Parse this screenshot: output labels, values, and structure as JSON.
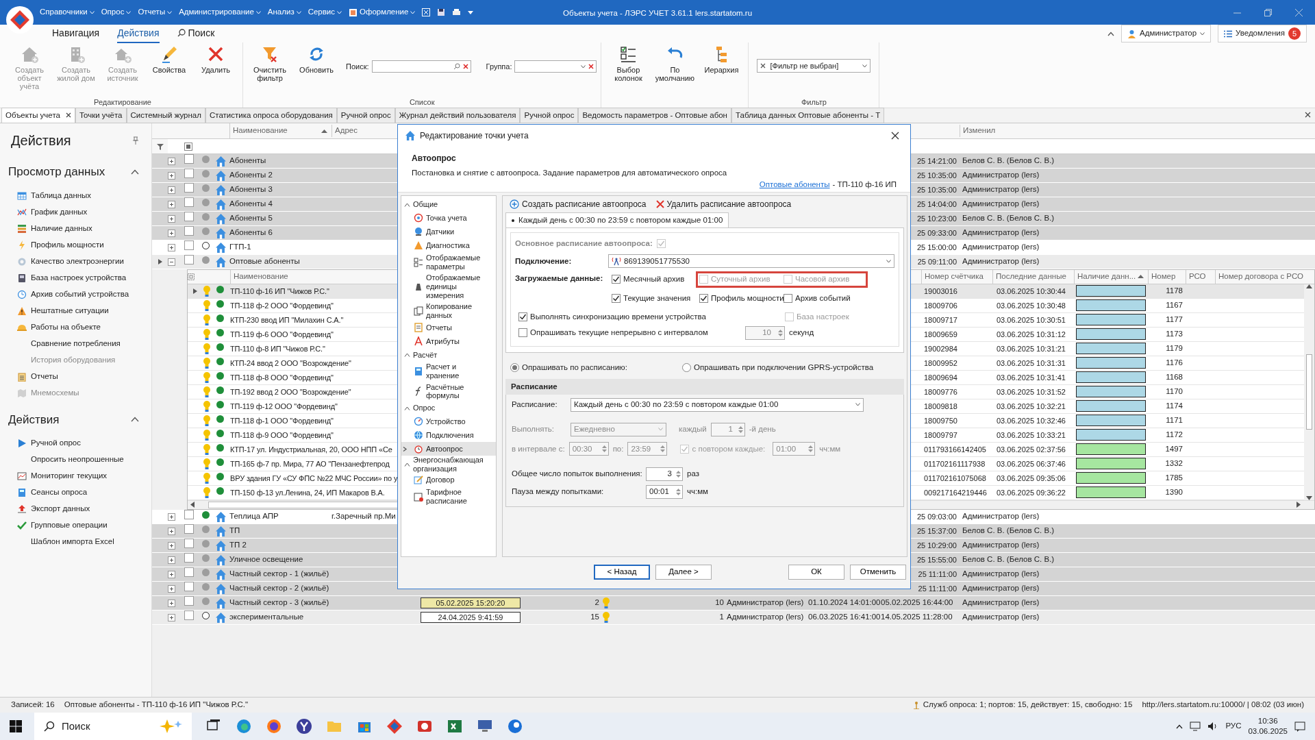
{
  "app": {
    "title": "Объекты учета - ЛЭРС УЧЕТ 3.61.1 lers.startatom.ru",
    "menu": [
      "Справочники",
      "Опрос",
      "Отчеты",
      "Администрирование",
      "Анализ",
      "Сервис",
      "Оформление"
    ]
  },
  "ribbon": {
    "tabs": [
      {
        "label": "Навигация",
        "selected": false
      },
      {
        "label": "Действия",
        "selected": true
      },
      {
        "label": "Поиск",
        "selected": false
      }
    ],
    "user": "Администратор",
    "notifications": {
      "label": "Уведомления",
      "count": "5"
    },
    "groups": [
      {
        "title": "Редактирование",
        "buttons": [
          {
            "label": "Создать объект учёта",
            "disabled": true
          },
          {
            "label": "Создать жилой дом",
            "disabled": true
          },
          {
            "label": "Создать источник",
            "disabled": true
          },
          {
            "label": "Свойства",
            "disabled": false
          },
          {
            "label": "Удалить",
            "disabled": false
          }
        ]
      },
      {
        "title": "Список",
        "buttons": [
          {
            "label": "Очистить фильтр",
            "disabled": false
          },
          {
            "label": "Обновить",
            "disabled": false
          }
        ],
        "search_label": "Поиск:",
        "group_label": "Группа:"
      },
      {
        "buttons": [
          {
            "label": "Выбор колонок",
            "disabled": false
          },
          {
            "label": "По умолчанию",
            "disabled": false
          },
          {
            "label": "Иерархия",
            "disabled": false
          }
        ]
      },
      {
        "title": "Фильтр",
        "filter": "[Фильтр не выбран]"
      }
    ]
  },
  "doc_tabs": [
    {
      "label": "Объекты учета",
      "selected": true
    },
    {
      "label": "Точки учёта",
      "selected": false
    },
    {
      "label": "Системный журнал",
      "selected": false
    },
    {
      "label": "Статистика опроса оборудования",
      "selected": false
    },
    {
      "label": "Ручной опрос",
      "selected": false
    },
    {
      "label": "Журнал действий пользователя",
      "selected": false
    },
    {
      "label": "Ручной опрос",
      "selected": false
    },
    {
      "label": "Ведомость параметров - Оптовые абон",
      "selected": false
    },
    {
      "label": "Таблица данных Оптовые абоненты - Т",
      "selected": false
    }
  ],
  "sidebar": {
    "title": "Действия",
    "sections": [
      {
        "title": "Просмотр данных",
        "expanded": true,
        "items": [
          {
            "label": "Таблица данных",
            "disabled": false
          },
          {
            "label": "График данных",
            "disabled": false
          },
          {
            "label": "Наличие данных",
            "disabled": false
          },
          {
            "label": "Профиль мощности",
            "disabled": false
          },
          {
            "label": "Качество электроэнергии",
            "disabled": false
          },
          {
            "label": "База настроек устройства",
            "disabled": false
          },
          {
            "label": "Архив событий устройства",
            "disabled": false
          },
          {
            "label": "Нештатные ситуации",
            "disabled": false
          },
          {
            "label": "Работы на объекте",
            "disabled": false
          },
          {
            "label": "Сравнение потребления",
            "disabled": false
          },
          {
            "label": "История оборудования",
            "disabled": true
          },
          {
            "label": "Отчеты",
            "disabled": false
          },
          {
            "label": "Мнемосхемы",
            "disabled": true
          }
        ]
      },
      {
        "title": "Действия",
        "expanded": true,
        "items": [
          {
            "label": "Ручной опрос",
            "disabled": false
          },
          {
            "label": "Опросить неопрошенные",
            "disabled": false
          },
          {
            "label": "Мониторинг текущих",
            "disabled": false
          },
          {
            "label": "Сеансы опроса",
            "disabled": false
          },
          {
            "label": "Экспорт данных",
            "disabled": false
          },
          {
            "label": "Групповые операции",
            "disabled": false
          },
          {
            "label": "Шаблон импорта Excel",
            "disabled": false
          }
        ]
      }
    ]
  },
  "grid": {
    "columns": [
      "Наименование",
      "Адрес",
      "Изменил"
    ],
    "rows": [
      {
        "name": "Абоненты",
        "color": "#d4d4d4",
        "dot": {
          "color": "#9d9d9d",
          "hollow": false
        },
        "checked": false,
        "expanded": false,
        "modified": "25 14:21:00",
        "modified_by": "Белов С. В. (Белов С. В.)"
      },
      {
        "name": "Абоненты 2",
        "color": "#d4d4d4",
        "dot": {
          "color": "#9d9d9d",
          "hollow": false
        },
        "checked": false,
        "expanded": false,
        "modified": "25 10:35:00",
        "modified_by": "Администратор (lers)"
      },
      {
        "name": "Абоненты 3",
        "color": "#d4d4d4",
        "dot": {
          "color": "#9d9d9d",
          "hollow": false
        },
        "checked": false,
        "expanded": false,
        "modified": "25 10:35:00",
        "modified_by": "Администратор (lers)"
      },
      {
        "name": "Абоненты 4",
        "color": "#d4d4d4",
        "dot": {
          "color": "#9d9d9d",
          "hollow": false
        },
        "checked": false,
        "expanded": false,
        "modified": "25 14:04:00",
        "modified_by": "Администратор (lers)"
      },
      {
        "name": "Абоненты 5",
        "color": "#d4d4d4",
        "dot": {
          "color": "#9d9d9d",
          "hollow": false
        },
        "checked": false,
        "expanded": false,
        "modified": "25 10:23:00",
        "modified_by": "Белов С. В. (Белов С. В.)"
      },
      {
        "name": "Абоненты 6",
        "color": "#d4d4d4",
        "dot": {
          "color": "#9d9d9d",
          "hollow": false
        },
        "checked": false,
        "expanded": false,
        "modified": "25 09:33:00",
        "modified_by": "Администратор (lers)"
      },
      {
        "name": "ГТП-1",
        "color": "#ffffff",
        "dot": {
          "color": "#ffffff",
          "hollow": true
        },
        "checked": false,
        "expanded": false,
        "modified": "25 15:00:00",
        "modified_by": "Администратор (lers)"
      },
      {
        "name": "Оптовые абоненты",
        "color": "#ebebeb",
        "dot": {
          "color": "#9d9d9d",
          "hollow": false
        },
        "checked": false,
        "expanded": true,
        "current": true,
        "modified": "25 09:11:00",
        "modified_by": "Администратор (lers)"
      }
    ],
    "detail": {
      "columns": [
        "Наименование",
        "Номер счётчика",
        "Последние данные",
        "Наличие данн...",
        "Номер",
        "РСО",
        "Номер договора с РСО"
      ],
      "rows": [
        {
          "name": "ТП-110 ф-16  ИП \"Чижов Р.С.\"",
          "meter": "19003016",
          "last": "03.06.2025 10:30:44",
          "color": "#add8e6",
          "number": "1178",
          "selected": true
        },
        {
          "name": "ТП-118 ф-2  ООО \"Фордевинд\"",
          "meter": "18009706",
          "last": "03.06.2025 10:30:48",
          "color": "#add8e6",
          "number": "1167",
          "selected": false
        },
        {
          "name": "КТП-230 ввод  ИП \"Милахин С.А.\"",
          "meter": "18009717",
          "last": "03.06.2025 10:30:51",
          "color": "#add8e6",
          "number": "1177",
          "selected": false
        },
        {
          "name": "ТП-119 ф-6  ООО \"Фордевинд\"",
          "meter": "18009659",
          "last": "03.06.2025 10:31:12",
          "color": "#add8e6",
          "number": "1173",
          "selected": false
        },
        {
          "name": "ТП-110 ф-8  ИП \"Чижов Р.С.\"",
          "meter": "19002984",
          "last": "03.06.2025 10:31:21",
          "color": "#add8e6",
          "number": "1179",
          "selected": false
        },
        {
          "name": "КТП-24 ввод 2  ООО \"Возрождение\"",
          "meter": "18009952",
          "last": "03.06.2025 10:31:31",
          "color": "#add8e6",
          "number": "1176",
          "selected": false
        },
        {
          "name": "ТП-118 ф-8  ООО \"Фордевинд\"",
          "meter": "18009694",
          "last": "03.06.2025 10:31:41",
          "color": "#add8e6",
          "number": "1168",
          "selected": false
        },
        {
          "name": "ТП-192 ввод 2  ООО \"Возрождение\"",
          "meter": "18009776",
          "last": "03.06.2025 10:31:52",
          "color": "#add8e6",
          "number": "1170",
          "selected": false
        },
        {
          "name": "ТП-119 ф-12  ООО \"Фордевинд\"",
          "meter": "18009818",
          "last": "03.06.2025 10:32:21",
          "color": "#add8e6",
          "number": "1174",
          "selected": false
        },
        {
          "name": "ТП-118 ф-1  ООО \"Фордевинд\"",
          "meter": "18009750",
          "last": "03.06.2025 10:32:46",
          "color": "#add8e6",
          "number": "1171",
          "selected": false
        },
        {
          "name": "ТП-118 ф-9  ООО \"Фордевинд\"",
          "meter": "18009797",
          "last": "03.06.2025 10:33:21",
          "color": "#add8e6",
          "number": "1172",
          "selected": false
        },
        {
          "name": "КТП-17 ул. Индустриальная, 20, ООО НПП «Се",
          "meter": "011793166142405",
          "last": "03.06.2025 02:37:56",
          "color": "#a6e6a0",
          "number": "1497",
          "selected": false
        },
        {
          "name": "ТП-165 ф-7  пр. Мира, 77  АО \"Пензанефтепрод",
          "meter": "011702161117938",
          "last": "03.06.2025 06:37:46",
          "color": "#a6e6a0",
          "number": "1332",
          "selected": false
        },
        {
          "name": "ВРУ здания ГУ «СУ ФПС №22 МЧС России» по у",
          "meter": "011702161075068",
          "last": "03.06.2025 09:35:06",
          "color": "#a6e6a0",
          "number": "1785",
          "selected": false
        },
        {
          "name": "ТП-150 ф-13  ул.Ленина, 24,  ИП Макаров В.А.",
          "meter": "009217164219446",
          "last": "03.06.2025 09:36:22",
          "color": "#a6e6a0",
          "number": "1390",
          "selected": false
        }
      ]
    },
    "rows_after": [
      {
        "name": "Теплица АПР",
        "address": "г.Заречный пр.Ми",
        "color": "#ffffff",
        "dot": {
          "color": "#1f8f3a",
          "hollow": false
        },
        "checked": false,
        "expanded": false,
        "modified": "25 09:03:00",
        "modified_by": "Администратор (lers)"
      },
      {
        "name": "ТП",
        "color": "#d4d4d4",
        "dot": {
          "color": "#9d9d9d",
          "hollow": false
        },
        "checked": false,
        "expanded": false,
        "modified": "25 15:37:00",
        "modified_by": "Белов С. В. (Белов С. В.)"
      },
      {
        "name": "ТП 2",
        "color": "#d4d4d4",
        "dot": {
          "color": "#9d9d9d",
          "hollow": false
        },
        "checked": false,
        "expanded": false,
        "modified": "25 10:29:00",
        "modified_by": "Администратор (lers)"
      },
      {
        "name": "Уличное освещение",
        "color": "#d4d4d4",
        "dot": {
          "color": "#9d9d9d",
          "hollow": false
        },
        "checked": false,
        "expanded": false,
        "modified": "25 15:55:00",
        "modified_by": "Белов С. В. (Белов С. В.)"
      },
      {
        "name": "Частный сектор - 1 (жильё)",
        "color": "#d4d4d4",
        "dot": {
          "color": "#9d9d9d",
          "hollow": false
        },
        "checked": false,
        "expanded": false,
        "modified": "25 11:11:00",
        "modified_by": "Администратор (lers)"
      },
      {
        "name": "Частный сектор - 2 (жильё)",
        "color": "#d4d4d4",
        "dot": {
          "color": "#9d9d9d",
          "hollow": false
        },
        "checked": false,
        "expanded": false,
        "modified": "25 11:11:00",
        "modified_by": "Администратор (lers)"
      },
      {
        "name": "Частный сектор - 3 (жильё)",
        "color": "#d4d4d4",
        "dot": {
          "color": "#9d9d9d",
          "hollow": false
        },
        "checked": false,
        "expanded": false,
        "date_box": {
          "text": "05.02.2025 15:20:20",
          "color": "#eee8a6"
        },
        "count": "2",
        "number": "10",
        "created_by": "Администратор (lers)",
        "created": "01.10.2024 14:01:00",
        "modified": "05.02.2025 16:44:00",
        "modified_by": "Администратор (lers)"
      },
      {
        "name": "экспериментальные",
        "color": "#ebebeb",
        "dot": {
          "color": "#ffffff",
          "hollow": true
        },
        "checked": false,
        "expanded": false,
        "date_box": {
          "text": "24.04.2025 9:41:59",
          "color": "#ffffff"
        },
        "count": "15",
        "number": "1",
        "created_by": "Администратор (lers)",
        "created": "06.03.2025 16:41:00",
        "modified": "14.05.2025 11:28:00",
        "modified_by": "Администратор (lers)"
      }
    ]
  },
  "dialog": {
    "title": "Редактирование точки учета",
    "heading": "Автоопрос",
    "description": "Постановка и снятие с автоопроса. Задание параметров для автоматического опроса",
    "link": "Оптовые абоненты",
    "record": "- ТП-110 ф-16  ИП",
    "nav": [
      {
        "label": "Общие",
        "expanded": true,
        "children": [
          {
            "label": "Точка учета",
            "selected": false
          },
          {
            "label": "Датчики",
            "selected": false
          },
          {
            "label": "Диагностика",
            "selected": false
          },
          {
            "label": "Отображаемые параметры",
            "selected": false
          },
          {
            "label": "Отображаемые единицы измерения",
            "selected": false
          },
          {
            "label": "Копирование данных",
            "selected": false
          },
          {
            "label": "Отчеты",
            "selected": false
          },
          {
            "label": "Атрибуты",
            "selected": false
          }
        ]
      },
      {
        "label": "Расчёт",
        "expanded": true,
        "children": [
          {
            "label": "Расчет и хранение",
            "selected": false
          },
          {
            "label": "Расчётные формулы",
            "selected": false
          }
        ]
      },
      {
        "label": "Опрос",
        "expanded": true,
        "children": [
          {
            "label": "Устройство",
            "selected": false
          },
          {
            "label": "Подключения",
            "selected": false
          },
          {
            "label": "Автоопрос",
            "selected": true
          }
        ]
      },
      {
        "label": "Энергоснабжающая организация",
        "expanded": true,
        "children": [
          {
            "label": "Договор",
            "selected": false
          },
          {
            "label": "Тарифное расписание",
            "selected": false
          }
        ]
      }
    ],
    "toolbar": [
      {
        "label": "Создать расписание автоопроса",
        "kind": "add"
      },
      {
        "label": "Удалить расписание автоопроса",
        "kind": "delete"
      }
    ],
    "tab": {
      "label": "Каждый день с 00:30 по 23:59 с повтором каждые 01:00",
      "selected": true
    },
    "main_schedule": {
      "label": "Основное расписание автоопроса:",
      "checked": true,
      "disabled": true
    },
    "connection": {
      "label": "Подключение:",
      "value": "869139051775530"
    },
    "data_label": "Загружаемые данные:",
    "options": [
      {
        "label": "Месячный архив",
        "checked": true,
        "disabled": false,
        "highlighted": false
      },
      {
        "label": "Суточный архив",
        "checked": false,
        "disabled": true,
        "highlighted": true
      },
      {
        "label": "Часовой архив",
        "checked": false,
        "disabled": true,
        "highlighted": true
      },
      {
        "label": "Текущие значения",
        "checked": true,
        "disabled": false,
        "highlighted": false
      },
      {
        "label": "Профиль мощности",
        "checked": true,
        "disabled": false,
        "highlighted": false
      },
      {
        "label": "Архив событий",
        "checked": false,
        "disabled": false,
        "highlighted": false
      }
    ],
    "sync": {
      "label": "Выполнять синхронизацию времени устройства",
      "checked": true,
      "disabled": false
    },
    "settings_base": {
      "label": "База настроек",
      "checked": false,
      "disabled": true
    },
    "continuous": {
      "label": "Опрашивать текущие непрерывно с интервалом",
      "checked": false,
      "value": "10",
      "unit": "секунд"
    },
    "modes": [
      {
        "label": "Опрашивать по расписанию:",
        "selected": true
      },
      {
        "label": "Опрашивать при подключении GPRS-устройства",
        "selected": false
      }
    ],
    "schedule": {
      "title": "Расписание",
      "label": "Расписание:",
      "value": "Каждый день с 00:30 по 23:59 с повтором каждые 01:00",
      "run_label": "Выполнять:",
      "run_value": "Ежедневно",
      "every_label": "каждый",
      "every_value": "1",
      "every_unit": "-й день",
      "from_label": "в интервале с:",
      "from": "00:30",
      "to_label": "по:",
      "to": "23:59",
      "repeat": {
        "label": "с повтором каждые:",
        "checked": true
      },
      "repeat_value": "01:00",
      "repeat_unit": "чч:мм",
      "attempts_label": "Общее число попыток выполнения:",
      "attempts": "3",
      "attempts_unit": "раз",
      "pause_label": "Пауза между попытками:",
      "pause": "00:01",
      "pause_unit": "чч:мм"
    },
    "buttons": [
      {
        "label": "< Назад",
        "focused": true
      },
      {
        "label": "Далее >",
        "focused": false
      },
      {
        "label": "ОК",
        "focused": false
      },
      {
        "label": "Отменить",
        "focused": false
      }
    ]
  },
  "status_bar": {
    "records": "Записей: 16",
    "current": "Оптовые абоненты - ТП-110 ф-16  ИП \"Чижов Р.С.\"",
    "services": "Служб опроса: 1; портов: 15, действует: 15, свободно: 15",
    "server": "http://lers.startatom.ru:10000/ | 08:02 (03 июн)"
  },
  "taskbar": {
    "search": "Поиск",
    "language": "РУС",
    "time": "10:36",
    "date": "03.06.2025"
  }
}
